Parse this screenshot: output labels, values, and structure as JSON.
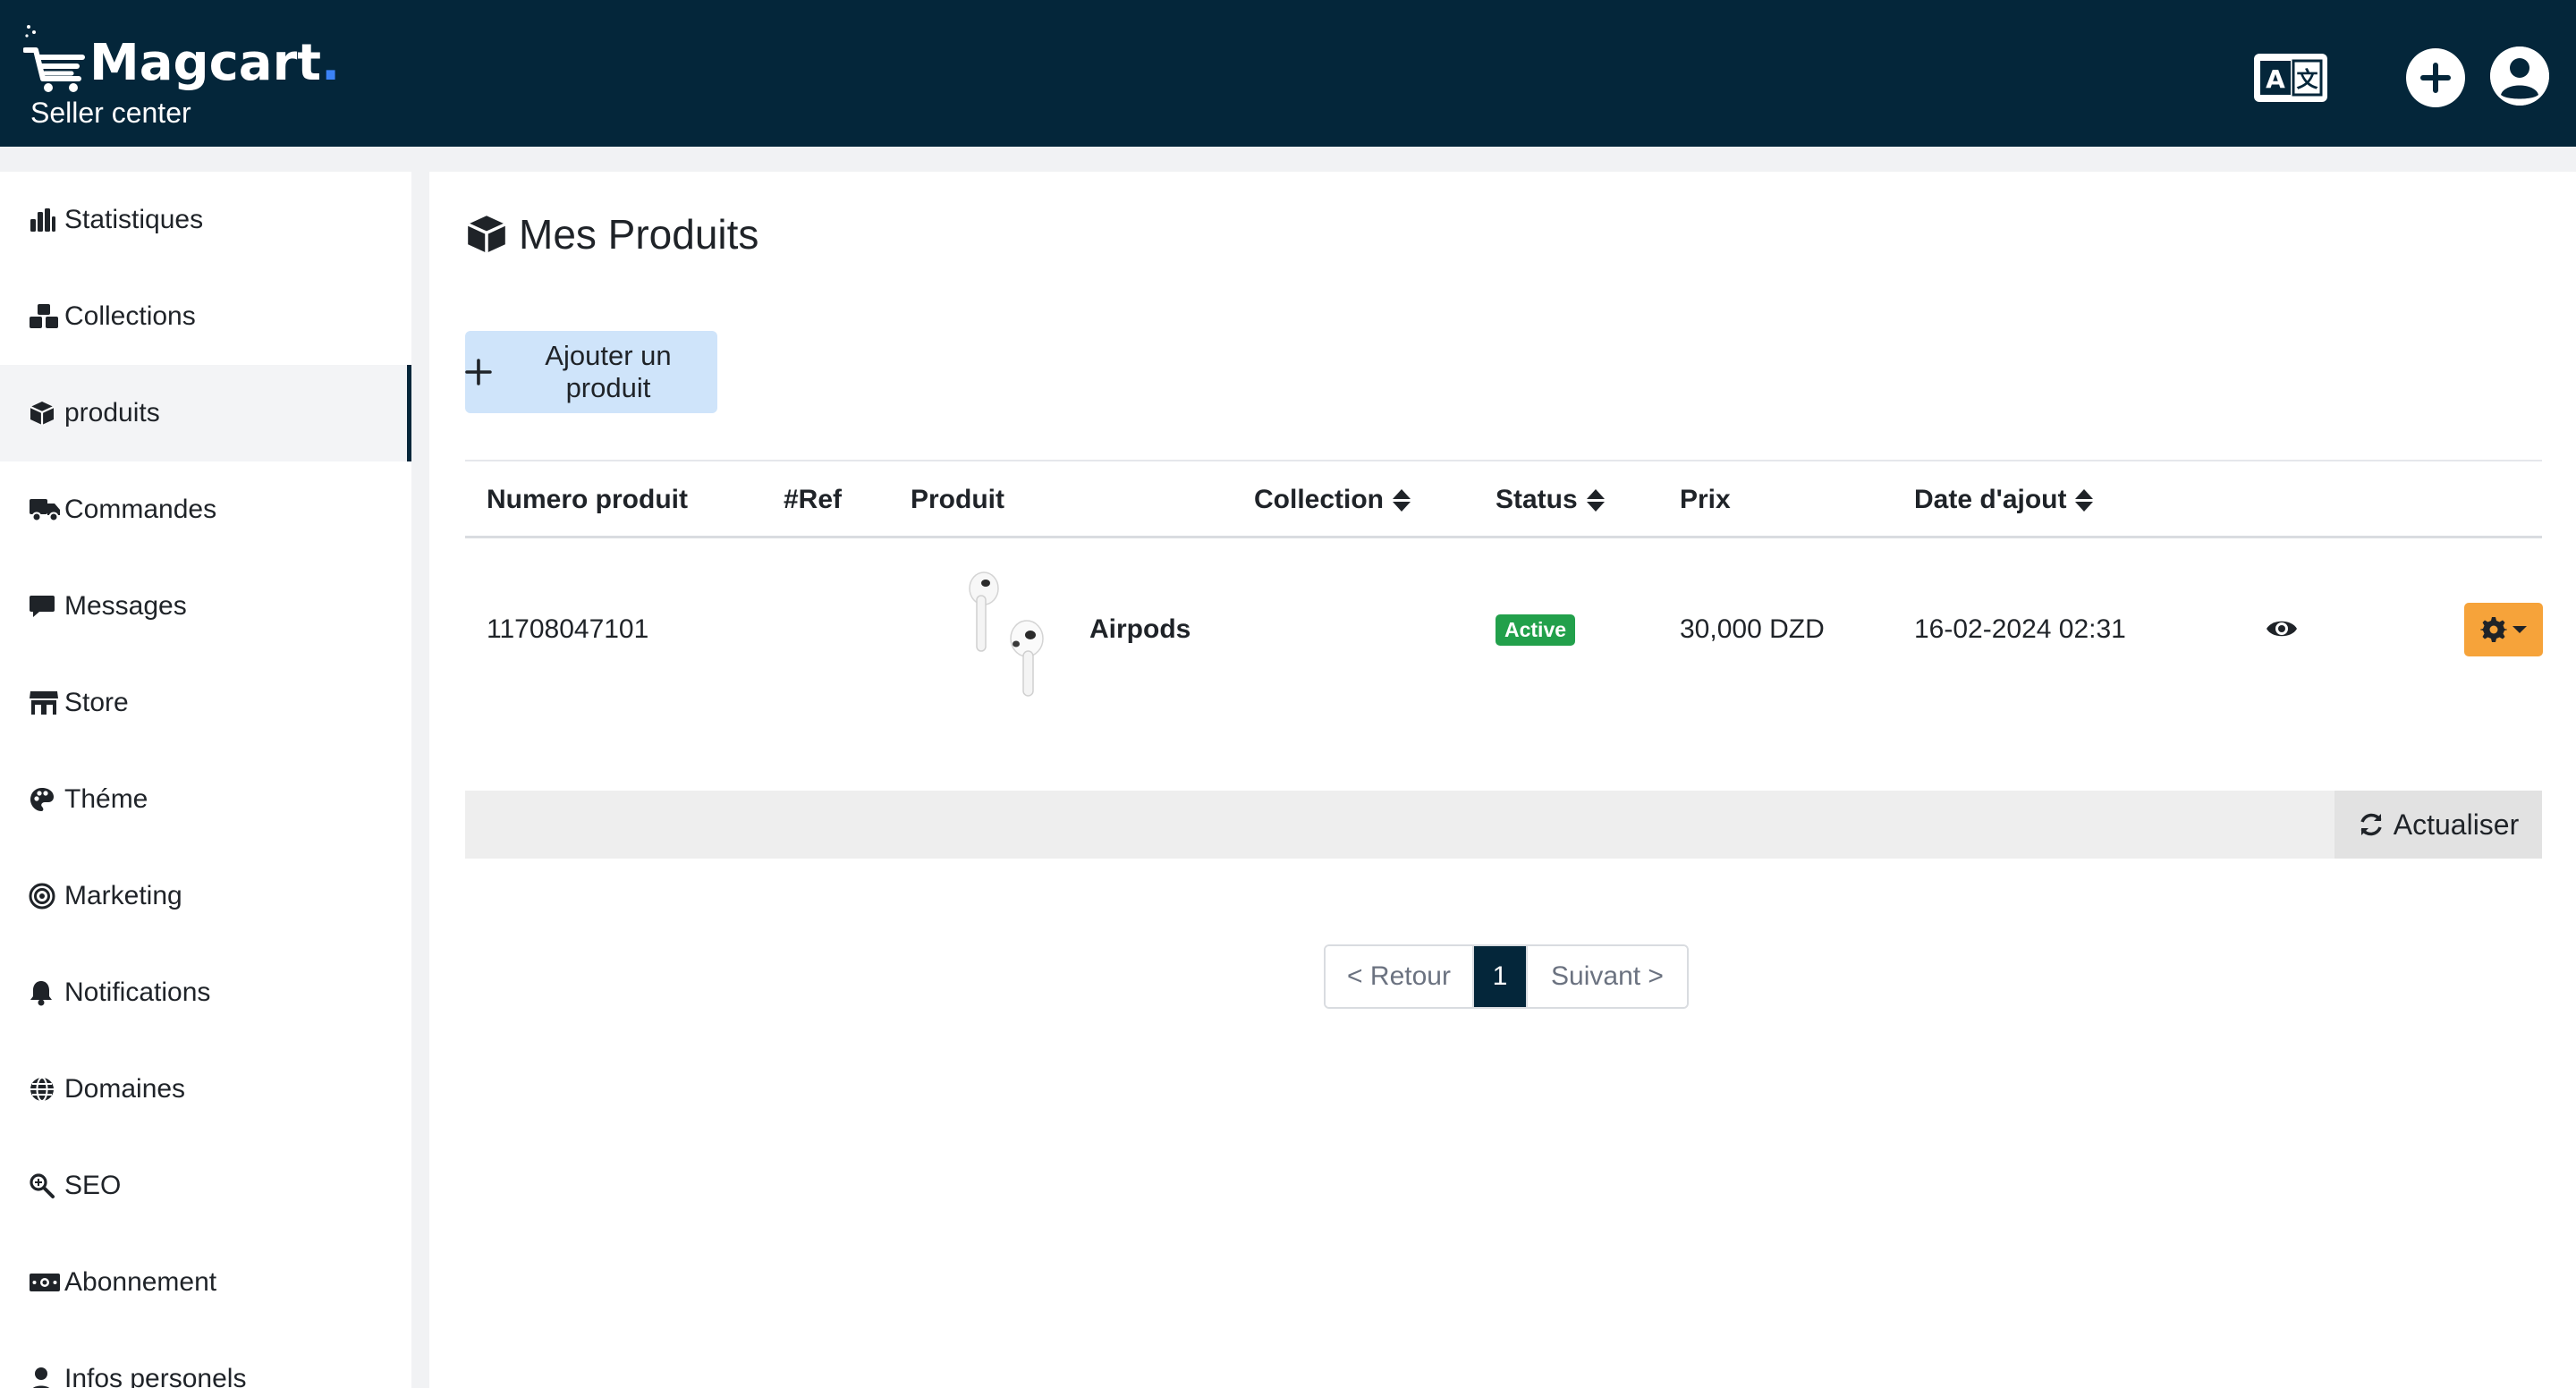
{
  "header": {
    "brand": "Magcart",
    "brand_dot": ".",
    "subtitle": "Seller center"
  },
  "sidebar": {
    "items": [
      {
        "label": "Statistiques",
        "icon": "bar-chart-icon"
      },
      {
        "label": "Collections",
        "icon": "boxes-icon"
      },
      {
        "label": "produits",
        "icon": "box-icon",
        "active": true
      },
      {
        "label": "Commandes",
        "icon": "truck-icon"
      },
      {
        "label": "Messages",
        "icon": "message-icon"
      },
      {
        "label": "Store",
        "icon": "store-icon"
      },
      {
        "label": "Théme",
        "icon": "palette-icon"
      },
      {
        "label": "Marketing",
        "icon": "target-icon"
      },
      {
        "label": "Notifications",
        "icon": "bell-icon"
      },
      {
        "label": "Domaines",
        "icon": "globe-icon"
      },
      {
        "label": "SEO",
        "icon": "magnify-icon"
      },
      {
        "label": "Abonnement",
        "icon": "money-icon"
      },
      {
        "label": "Infos personels",
        "icon": "user-icon"
      }
    ]
  },
  "main": {
    "title": "Mes Produits",
    "add_button": "Ajouter un produit",
    "table": {
      "columns": [
        "Numero produit",
        "#Ref",
        "Produit",
        "Collection",
        "Status",
        "Prix",
        "Date d'ajout"
      ],
      "rows": [
        {
          "numero": "11708047101",
          "ref": "",
          "produit": "Airpods",
          "collection": "",
          "status": "Active",
          "prix": "30,000 DZD",
          "date": "16-02-2024 02:31"
        }
      ]
    },
    "refresh_button": "Actualiser",
    "pagination": {
      "prev": "< Retour",
      "current": "1",
      "next": "Suivant >"
    }
  },
  "colors": {
    "header_bg": "#04263a",
    "add_button_bg": "#cfe4fa",
    "status_active": "#22a04b",
    "action_button": "#f6a33a",
    "brand_dot": "#3b82f6"
  }
}
